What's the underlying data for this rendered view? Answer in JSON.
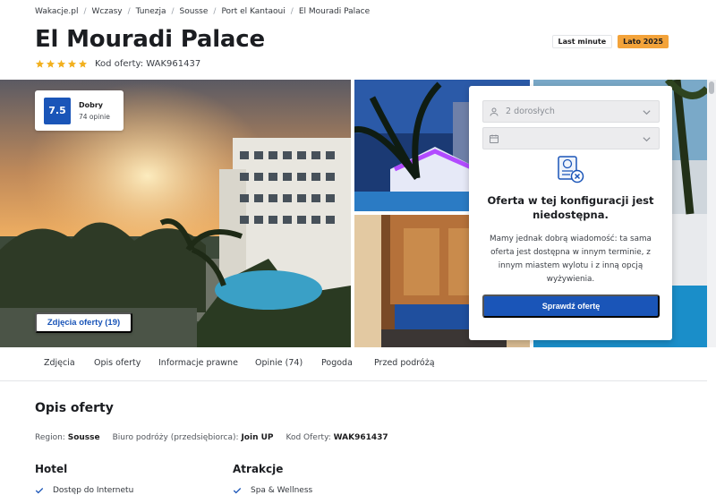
{
  "breadcrumb": [
    "Wakacje.pl",
    "Wczasy",
    "Tunezja",
    "Sousse",
    "Port el Kantaoui",
    "El Mouradi Palace"
  ],
  "hotel": {
    "name": "El Mouradi Palace",
    "stars": 5,
    "offer_code_label": "Kod oferty: WAK961437"
  },
  "badges": {
    "last_minute": "Last minute",
    "season": "Lato 2025"
  },
  "score": {
    "value": "7.5",
    "label": "Dobry",
    "count": "74 opinie"
  },
  "gallery": {
    "photos_button": "Zdjęcia oferty (19)"
  },
  "offer_panel": {
    "guests": "2 dorosłych",
    "date": "",
    "title": "Oferta w tej konfiguracji jest niedostępna.",
    "description": "Mamy jednak dobrą wiadomość: ta sama oferta jest dostępna w innym terminie, z innym miastem wylotu i z inną opcją wyżywienia.",
    "button": "Sprawdź ofertę"
  },
  "tabs": [
    "Zdjęcia",
    "Opis oferty",
    "Informacje prawne",
    "Opinie (74)",
    "Pogoda",
    "Przed podróżą"
  ],
  "description": {
    "title": "Opis oferty",
    "region_label": "Region:",
    "region_value": "Sousse",
    "operator_label": "Biuro podróży (przedsiębiorca):",
    "operator_value": "Join UP",
    "code_label": "Kod Oferty:",
    "code_value": "WAK961437"
  },
  "amenities": {
    "hotel_title": "Hotel",
    "hotel_first": "Dostęp do Internetu",
    "attractions_title": "Atrakcje",
    "attractions_first": "Spa & Wellness"
  },
  "colors": {
    "primary": "#1a55b8",
    "star": "#f2b01e",
    "badge_season": "#f3a33a"
  }
}
